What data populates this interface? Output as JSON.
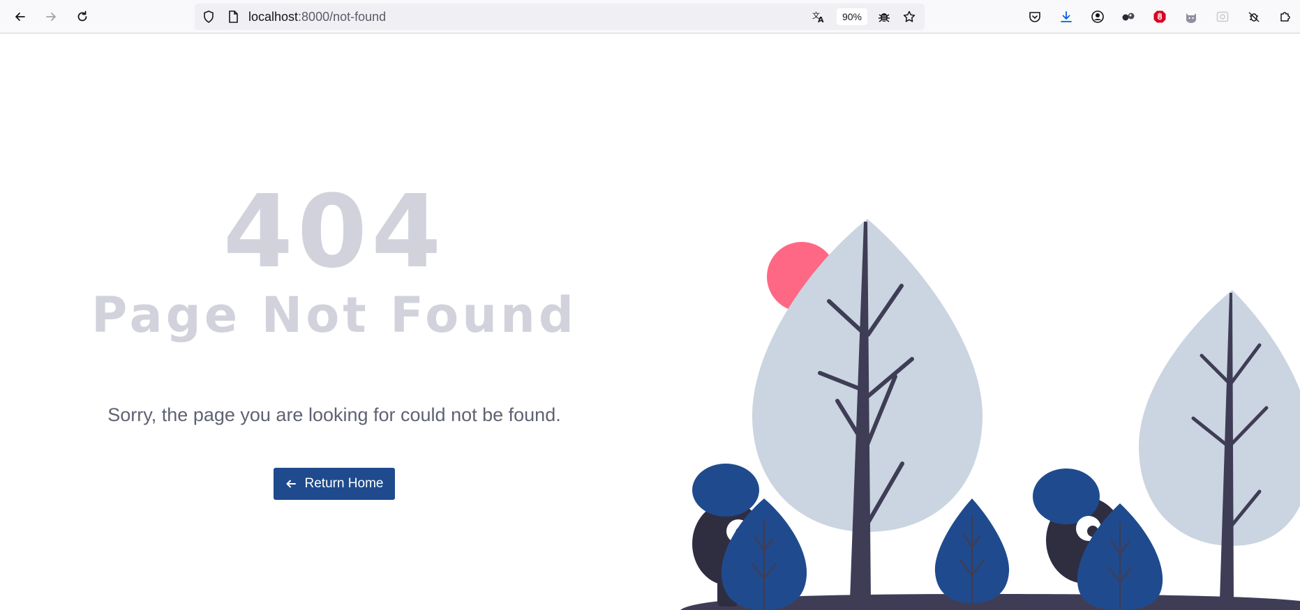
{
  "browser": {
    "url_host": "localhost",
    "url_path": ":8000/not-found",
    "zoom": "90%"
  },
  "page": {
    "code": "404",
    "title": "Page Not Found",
    "message": "Sorry, the page you are looking for could not be found.",
    "button_label": "Return Home"
  },
  "colors": {
    "accent": "#1f4b8e",
    "muted_heading": "#d1d2db",
    "tree_leaf": "#cbd5e1",
    "sun": "#ff6884",
    "trunk": "#3f3d56"
  }
}
